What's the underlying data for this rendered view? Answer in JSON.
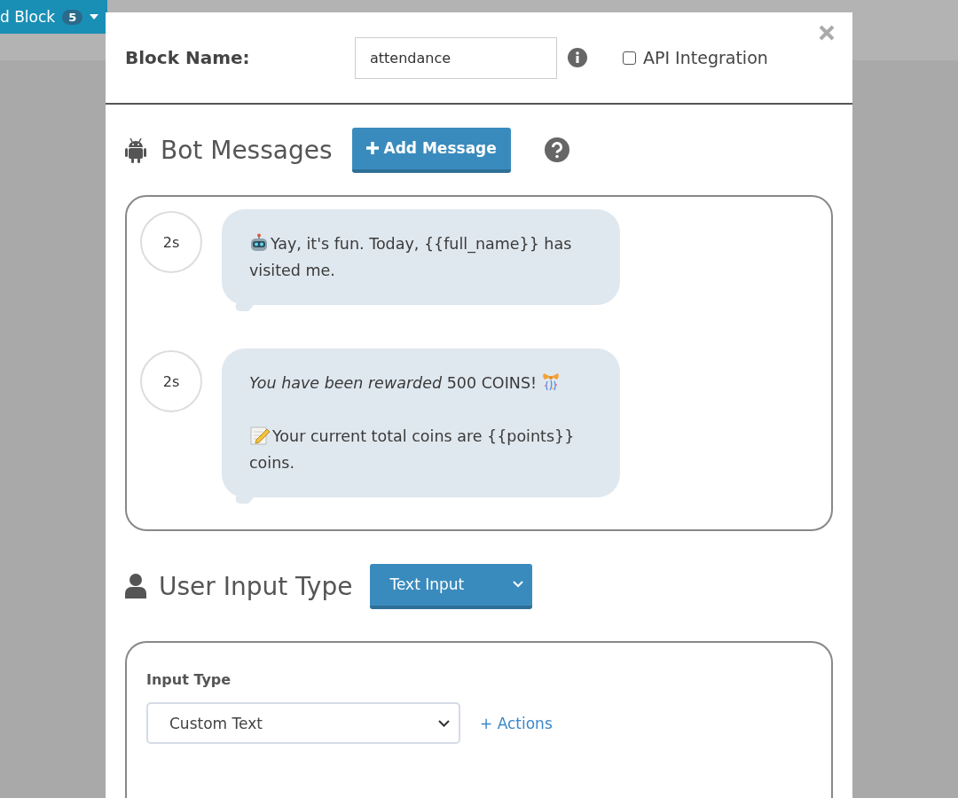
{
  "background": {
    "add_block_button": {
      "label": "d Block",
      "count": "5"
    }
  },
  "modal": {
    "block_name": {
      "label": "Block Name:",
      "value": "attendance"
    },
    "api_integration": {
      "label": "API Integration",
      "checked": false
    },
    "bot_messages": {
      "title": "Bot Messages",
      "add_button": "Add Message",
      "messages": [
        {
          "delay": "2s",
          "paragraphs": [
            {
              "kind": "robot",
              "text": "Yay, it's fun. Today, {{full_name}} has visited me."
            }
          ]
        },
        {
          "delay": "2s",
          "paragraphs": [
            {
              "kind": "confetti",
              "text": "*You have been rewarded* 500 COINS!"
            },
            {
              "kind": "memo",
              "text": "Your current total coins are {{points}} coins."
            }
          ]
        }
      ]
    },
    "user_input": {
      "title": "User Input Type",
      "type_dropdown": "Text Input",
      "input_type": {
        "label": "Input Type",
        "value": "Custom Text"
      },
      "actions_link": "+ Actions"
    }
  }
}
